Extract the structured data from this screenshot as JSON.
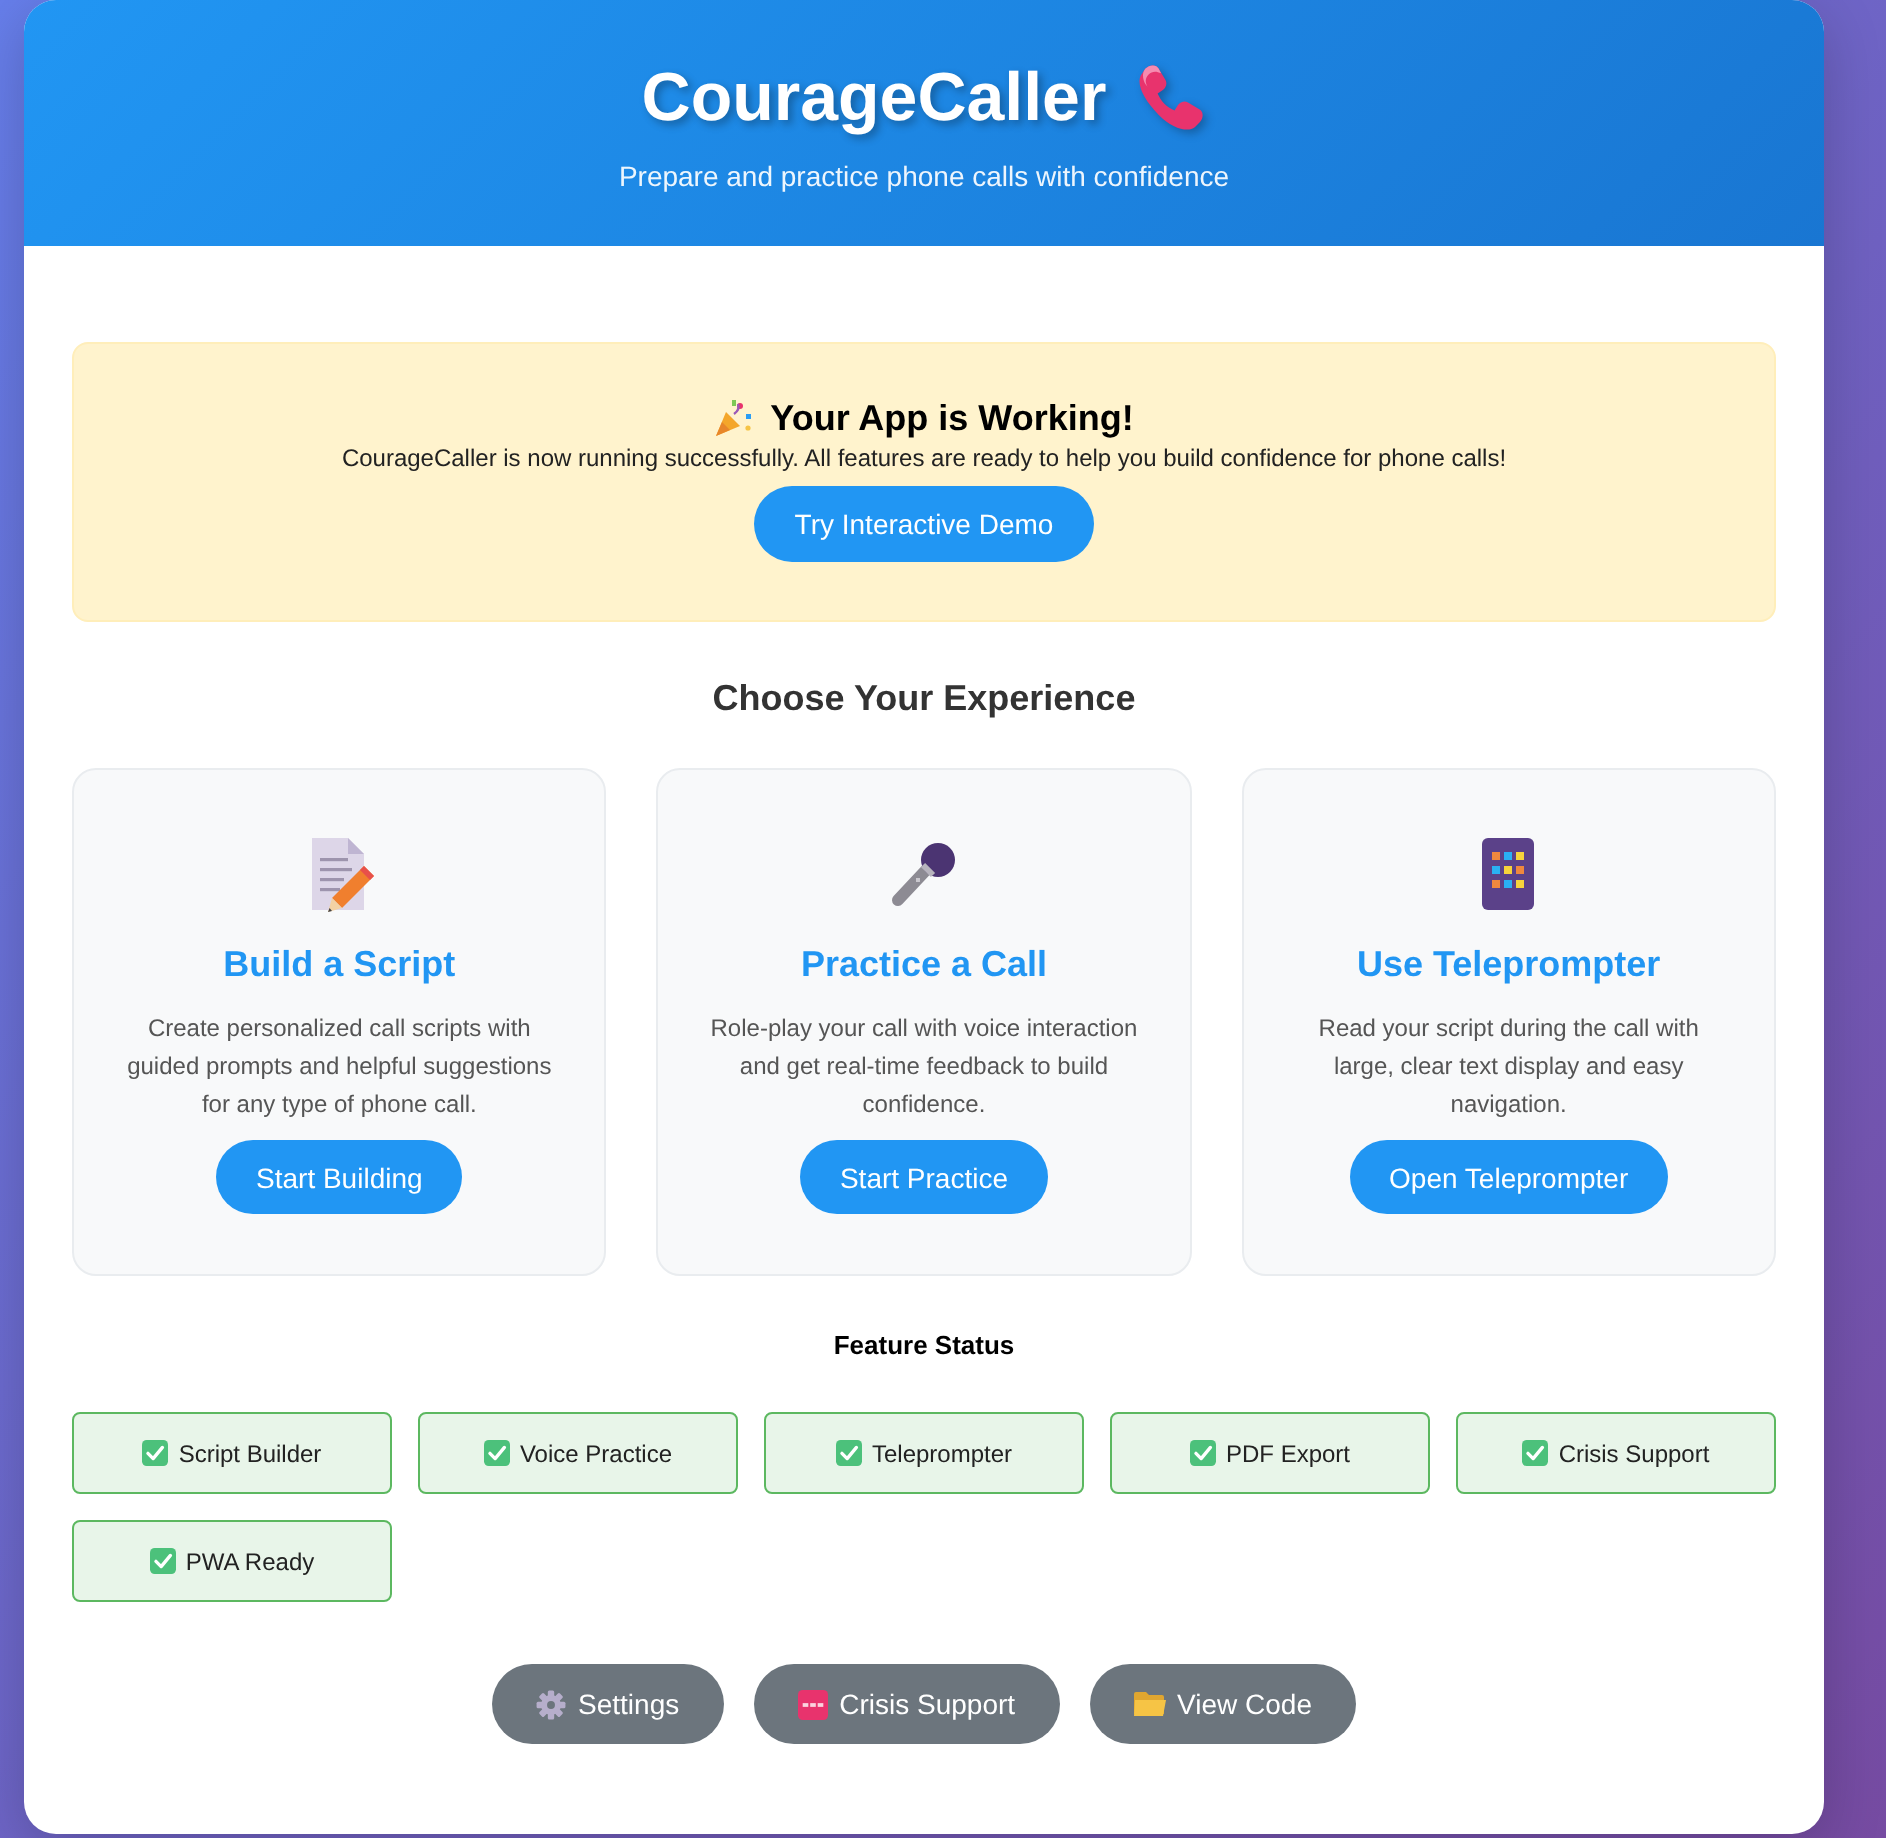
{
  "header": {
    "title": "CourageCaller",
    "subtitle": "Prepare and practice phone calls with confidence"
  },
  "banner": {
    "title": "Your App is Working!",
    "message": "CourageCaller is now running successfully. All features are ready to help you build confidence for phone calls!",
    "button": "Try Interactive Demo"
  },
  "experience": {
    "heading": "Choose Your Experience",
    "cards": [
      {
        "title": "Build a Script",
        "description": "Create personalized call scripts with guided prompts and helpful suggestions for any type of phone call.",
        "button": "Start Building"
      },
      {
        "title": "Practice a Call",
        "description": "Role-play your call with voice interaction and get real-time feedback to build confidence.",
        "button": "Start Practice"
      },
      {
        "title": "Use Teleprompter",
        "description": "Read your script during the call with large, clear text display and easy navigation.",
        "button": "Open Teleprompter"
      }
    ]
  },
  "feature_status": {
    "heading": "Feature Status",
    "features": [
      {
        "label": "Script Builder",
        "ready": true
      },
      {
        "label": "Voice Practice",
        "ready": true
      },
      {
        "label": "Teleprompter",
        "ready": true
      },
      {
        "label": "PDF Export",
        "ready": true
      },
      {
        "label": "Crisis Support",
        "ready": true
      },
      {
        "label": "PWA Ready",
        "ready": true
      }
    ]
  },
  "actions": [
    {
      "label": "Settings"
    },
    {
      "label": "Crisis Support"
    },
    {
      "label": "View Code"
    }
  ]
}
